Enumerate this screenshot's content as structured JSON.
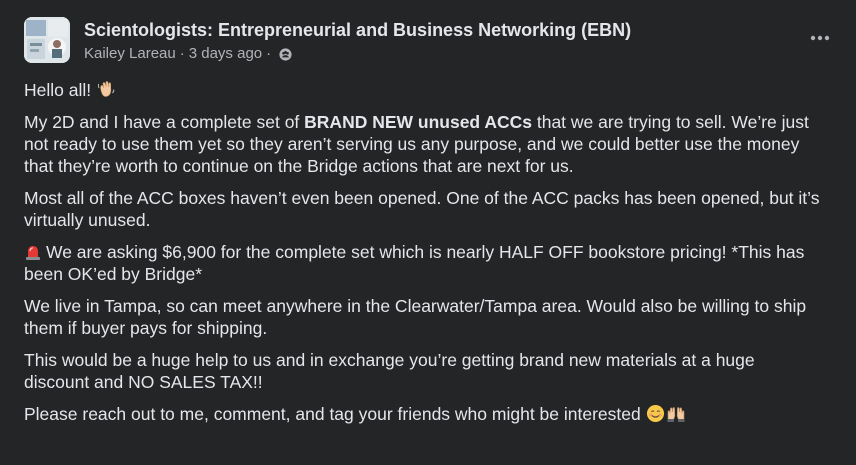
{
  "group": {
    "name": "Scientologists: Entrepreneurial and Business Networking (EBN)"
  },
  "author": {
    "name": "Kailey Lareau",
    "separator": "·",
    "time": "3 days ago",
    "audience_icon": "group-members-icon"
  },
  "menu_icon": "more-options-icon",
  "post": {
    "p1": "Hello all!",
    "p1_emoji": "waving-hand-icon",
    "p2_a": "My 2D and I have a complete set of ",
    "p2_bold": "BRAND NEW unused ACCs",
    "p2_b": " that we are trying to sell. We’re just not ready to use them yet so they aren’t serving us any purpose, and we could better use the money that they’re worth to continue on the Bridge actions that are next for us.",
    "p3": "Most all of the ACC boxes haven’t even been opened. One of the ACC packs has been opened, but it’s virtually unused.",
    "p4_emoji": "police-light-icon",
    "p4": "We are asking $6,900 for the complete set which is nearly HALF OFF bookstore pricing! *This has been OK’ed by Bridge*",
    "p5": "We live in Tampa, so can meet anywhere in the Clearwater/Tampa area. Would also be willing to ship them if buyer pays for shipping.",
    "p6": "This would be a huge help to us and in exchange you’re getting brand new materials at a huge discount and NO SALES TAX!!",
    "p7": "Please reach out to me, comment, and tag your friends who might be interested",
    "p7_emojis": [
      "smiling-face-icon",
      "raised-hands-icon"
    ]
  },
  "colors": {
    "background": "#242526",
    "primary_text": "#e4e6eb",
    "secondary_text": "#b0b3b8"
  }
}
